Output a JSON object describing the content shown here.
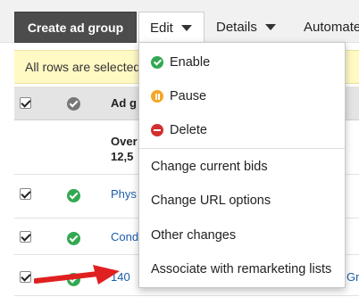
{
  "toolbar": {
    "create_label": "Create ad group",
    "edit_label": "Edit",
    "details_label": "Details",
    "automate_label": "Automate"
  },
  "banner": {
    "text": "All rows are selected"
  },
  "table": {
    "header_label": "Ad g",
    "overall_line1": "Over",
    "overall_line2": "12,5",
    "rows": [
      {
        "name": "Phys"
      },
      {
        "name": "Cond"
      },
      {
        "name": "140",
        "suffix": "Gro"
      }
    ]
  },
  "menu": {
    "enable": "Enable",
    "pause": "Pause",
    "delete": "Delete",
    "change_bids": "Change current bids",
    "change_urls": "Change URL options",
    "other_changes": "Other changes",
    "associate_remarketing": "Associate with remarketing lists"
  },
  "colors": {
    "enable": "#33a852",
    "pause": "#f5a623",
    "delete": "#d32f2f",
    "arrow": "#e02020",
    "banner": "#fff9c4"
  },
  "icons": {
    "enable": "check-circle-icon",
    "pause": "pause-circle-icon",
    "delete": "minus-circle-icon"
  }
}
